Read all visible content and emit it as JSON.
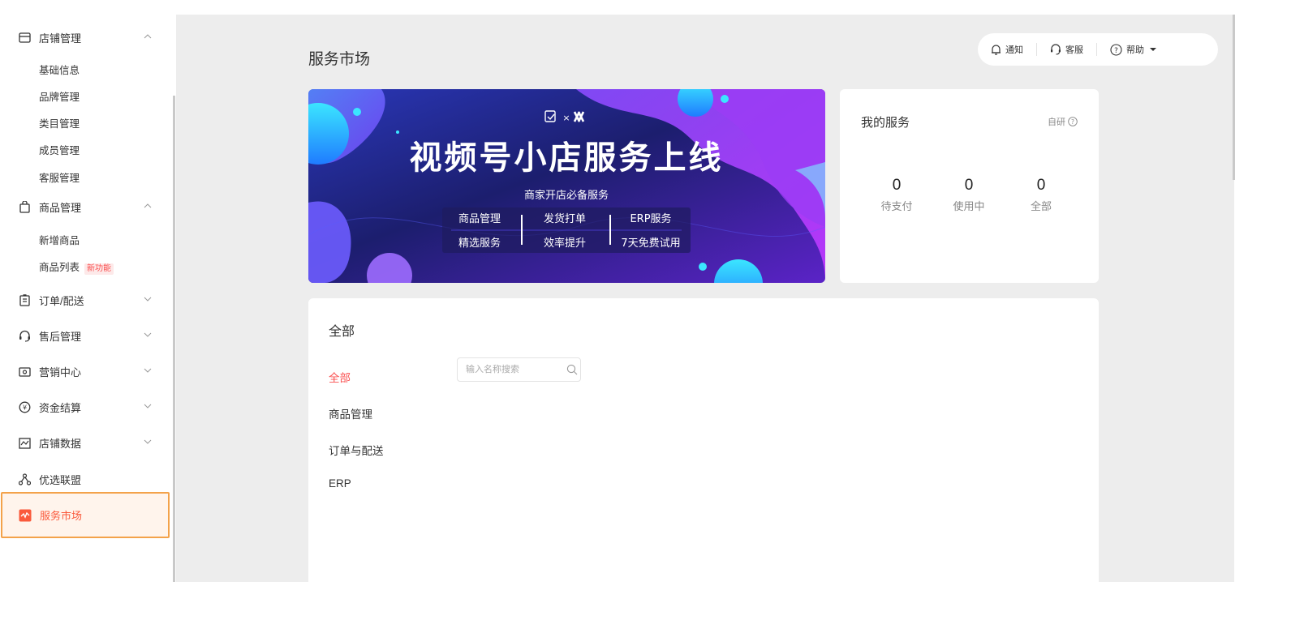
{
  "sidebar": {
    "groups": [
      {
        "label": "店铺管理",
        "icon": "store-icon",
        "expanded": true,
        "children": [
          "基础信息",
          "品牌管理",
          "类目管理",
          "成员管理",
          "客服管理"
        ]
      },
      {
        "label": "商品管理",
        "icon": "shopping-bag-icon",
        "expanded": true,
        "children": [
          "新增商品",
          "商品列表"
        ],
        "new_badge": "新功能"
      },
      {
        "label": "订单/配送",
        "icon": "clipboard-icon",
        "expanded": false
      },
      {
        "label": "售后管理",
        "icon": "headset-icon",
        "expanded": false
      },
      {
        "label": "营销中心",
        "icon": "ticket-icon",
        "expanded": false
      },
      {
        "label": "资金结算",
        "icon": "yuan-coin-icon",
        "expanded": false
      },
      {
        "label": "店铺数据",
        "icon": "chart-icon",
        "expanded": false
      },
      {
        "label": "优选联盟",
        "icon": "network-icon"
      },
      {
        "label": "服务市场",
        "icon": "service-market-icon",
        "active": true
      }
    ]
  },
  "header": {
    "title": "服务市场",
    "notify": "通知",
    "service": "客服",
    "help": "帮助"
  },
  "banner": {
    "headline": "视频号小店服务上线",
    "subtitle": "商家开店必备服务",
    "col1_top": "商品管理",
    "col1_bottom": "精选服务",
    "col2_top": "发货打单",
    "col2_bottom": "效率提升",
    "col3_top": "ERP服务",
    "col3_bottom": "7天免费试用",
    "logo_sep": "×"
  },
  "my_services": {
    "title": "我的服务",
    "self_dev": "自研",
    "stats": [
      {
        "value": "0",
        "label": "待支付"
      },
      {
        "value": "0",
        "label": "使用中"
      },
      {
        "value": "0",
        "label": "全部"
      }
    ]
  },
  "catalog": {
    "title": "全部",
    "categories": [
      "全部",
      "商品管理",
      "订单与配送",
      "ERP"
    ],
    "search_placeholder": "输入名称搜索"
  },
  "colors": {
    "accent": "#fa5151",
    "highlight_border": "#f3a24a",
    "arrow": "#f39a1e"
  }
}
